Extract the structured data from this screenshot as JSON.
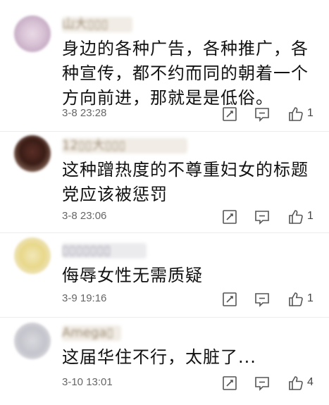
{
  "comments": [
    {
      "username": "山大▯▯▯",
      "text_lines": [
        "身边的各种广告，各种推广，各",
        "种宣传，都不约而同的朝着一个",
        "方向前进，那就是是低俗。"
      ],
      "time": "3-8 23:28",
      "likes": "1"
    },
    {
      "username": "12▯▯大▯▯▯",
      "text_lines": [
        "这种蹭热度的不尊重妇女的标题",
        "党应该被惩罚"
      ],
      "time": "3-8 23:06",
      "likes": "1"
    },
    {
      "username": "▯▯▯▯▯▯▯",
      "text_lines": [
        "侮辱女性无需质疑"
      ],
      "time": "3-9 19:16",
      "likes": "1"
    },
    {
      "username": "Amega▯",
      "text_lines": [
        "这届华住不行，太脏了..."
      ],
      "time": "3-10 13:01",
      "likes": "4"
    }
  ],
  "colors": {
    "text": "#111111",
    "meta": "#666666",
    "icon": "#555555"
  }
}
